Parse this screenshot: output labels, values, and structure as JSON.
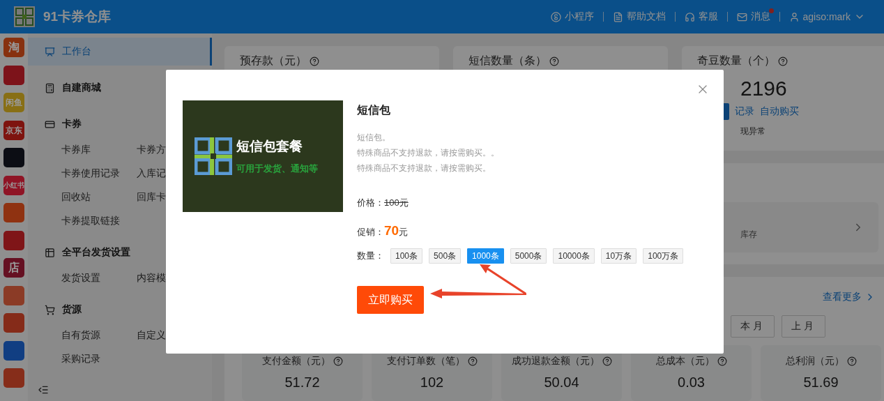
{
  "header": {
    "app_name": "91卡券仓库",
    "links": [
      {
        "kind": "miniapp",
        "label": "小程序",
        "unread": false
      },
      {
        "kind": "doc",
        "label": "帮助文档",
        "unread": false
      },
      {
        "kind": "service",
        "label": "客服",
        "unread": false
      },
      {
        "kind": "message",
        "label": "消息",
        "unread": true
      }
    ],
    "user": "agiso:mark"
  },
  "platforms": [
    {
      "color": "#87310f",
      "text": "淘"
    },
    {
      "color": "#7d131a"
    },
    {
      "color": "#886f15",
      "text": "闲鱼"
    },
    {
      "color": "#7e140f",
      "text": "京东"
    },
    {
      "color": "#0c0d14"
    },
    {
      "color": "#8f1425",
      "text": "小红书"
    },
    {
      "color": "#8f3211"
    },
    {
      "color": "#7f1518"
    },
    {
      "color": "#651022",
      "text": "店"
    },
    {
      "color": "#8b3b26"
    },
    {
      "color": "#852b19"
    },
    {
      "color": "#113e82"
    },
    {
      "color": "#862d1a"
    }
  ],
  "sidebar": {
    "sections": [
      {
        "kind": "workbench",
        "label": "工作台",
        "selected": true
      },
      {
        "kind": "mall",
        "label": "自建商城",
        "selected": false
      },
      {
        "kind": "card",
        "label": "卡券",
        "selected": false,
        "children": [
          {
            "label": "卡券库"
          },
          {
            "label": "卡券方"
          },
          {
            "label": "卡券使用记录"
          },
          {
            "label": "入库记"
          },
          {
            "label": "回收站"
          },
          {
            "label": "回库卡"
          },
          {
            "label": "卡券提取链接"
          }
        ]
      },
      {
        "kind": "delivery",
        "label": "全平台发货设置",
        "selected": false,
        "children": [
          {
            "label": "发货设置"
          },
          {
            "label": "内容模"
          }
        ]
      },
      {
        "kind": "source",
        "label": "货源",
        "selected": false,
        "children": [
          {
            "label": "自有货源"
          },
          {
            "label": "自定义"
          },
          {
            "label": "采购记录"
          }
        ]
      }
    ]
  },
  "overview": {
    "cards": [
      {
        "label": "预存款（元）"
      },
      {
        "label": "短信数量（条）"
      },
      {
        "label": "奇豆数量（个）",
        "value": "2196",
        "links": [
          "记录",
          "自动购买"
        ],
        "note": "现异常"
      }
    ]
  },
  "stock_panel": {
    "text": "库存"
  },
  "stats": {
    "more_link": "查看更多",
    "periods": [
      {
        "label": "本月",
        "selected": false
      },
      {
        "label": "上月",
        "selected": false
      }
    ],
    "metrics": [
      {
        "label": "支付金额（元）",
        "value": "51.72"
      },
      {
        "label": "支付订单数（笔）",
        "value": "102"
      },
      {
        "label": "成功退款金额（元）",
        "value": "50.04"
      },
      {
        "label": "总成本（元）",
        "value": "0.03"
      },
      {
        "label": "总利润（元）",
        "value": "51.69"
      }
    ]
  },
  "dialog": {
    "banner": {
      "title": "短信包套餐",
      "subtitle": "可用于发货、通知等"
    },
    "title": "短信包",
    "description": [
      "短信包。",
      "特殊商品不支持退款，请按需购买。。",
      "特殊商品不支持退款，请按需购买。"
    ],
    "price_label": "价格：",
    "price": "100元",
    "promo_label": "促销：",
    "promo_price": "70",
    "promo_unit": "元",
    "quantity_label": "数量：",
    "options": [
      {
        "label": "100条",
        "selected": false
      },
      {
        "label": "500条",
        "selected": false
      },
      {
        "label": "1000条",
        "selected": true
      },
      {
        "label": "5000条",
        "selected": false
      },
      {
        "label": "10000条",
        "selected": false
      },
      {
        "label": "10万条",
        "selected": false
      },
      {
        "label": "100万条",
        "selected": false
      }
    ],
    "buy_button": "立即购买"
  }
}
